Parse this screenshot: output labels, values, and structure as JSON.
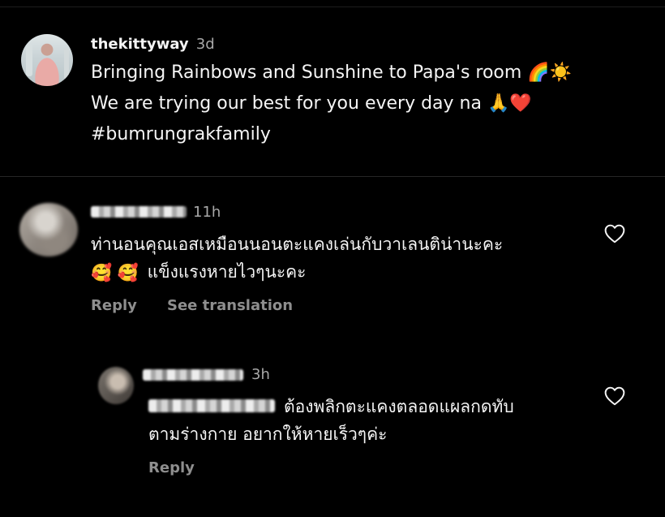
{
  "post": {
    "username": "thekittyway",
    "time": "3d",
    "caption_line1": "Bringing Rainbows and Sunshine to Papa's room",
    "caption_line1_emoji": "🌈☀️",
    "caption_line2": "We are trying our best for you every day na",
    "caption_line2_emoji": "🙏❤️",
    "caption_line3": "#bumrungrakfamily"
  },
  "comments": [
    {
      "time": "11h",
      "line1": "ท่านอนคุณเอสเหมือนนอนตะแคงเล่นกับวาเลนติน่านะคะ",
      "line2_emoji": "🥰 🥰",
      "line2": "แข็งแรงหายไวๆนะคะ",
      "reply_label": "Reply",
      "translate_label": "See translation",
      "like_icon": "heart-outline-icon"
    },
    {
      "time": "3h",
      "line1": "ต้องพลิกตะแคงตลอดแผลกดทับ",
      "line2": "ตามร่างกาย อยากให้หายเร็วๆค่ะ",
      "reply_label": "Reply",
      "like_icon": "heart-outline-icon"
    }
  ],
  "colors": {
    "background": "#000000",
    "primary_text": "#f5f5f5",
    "secondary_text": "#a8a8a8",
    "action_text": "#8e8e8e"
  }
}
